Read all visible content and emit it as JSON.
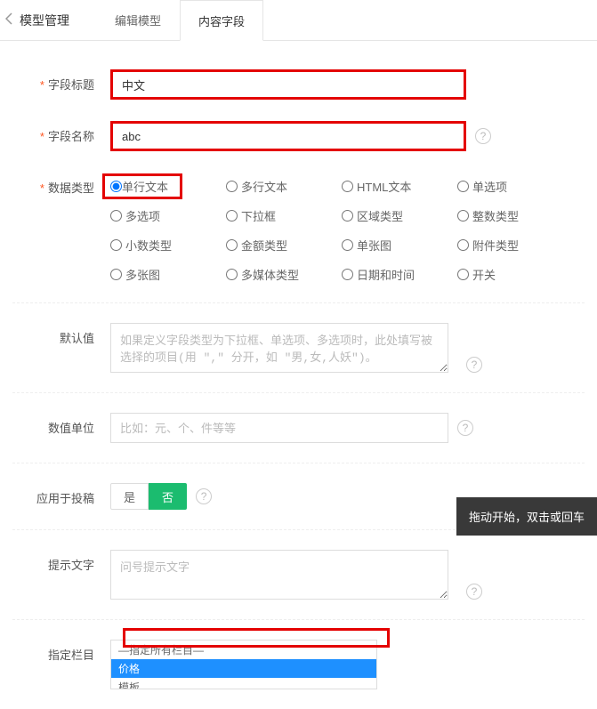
{
  "header": {
    "title": "模型管理",
    "tabs": [
      {
        "label": "编辑模型",
        "active": false
      },
      {
        "label": "内容字段",
        "active": true
      }
    ]
  },
  "form": {
    "field_title": {
      "label": "字段标题",
      "value": "中文"
    },
    "field_name": {
      "label": "字段名称",
      "value": "abc"
    },
    "data_type": {
      "label": "数据类型",
      "selected": "单行文本",
      "options": [
        "单行文本",
        "多行文本",
        "HTML文本",
        "单选项",
        "多选项",
        "下拉框",
        "区域类型",
        "整数类型",
        "小数类型",
        "金额类型",
        "单张图",
        "附件类型",
        "多张图",
        "多媒体类型",
        "日期和时间",
        "开关"
      ]
    },
    "default_value": {
      "label": "默认值",
      "placeholder": "如果定义字段类型为下拉框、单选项、多选项时，此处填写被选择的项目(用 \",\" 分开，如 \"男,女,人妖\")。"
    },
    "unit": {
      "label": "数值单位",
      "placeholder": "比如：元、个、件等等"
    },
    "contribute": {
      "label": "应用于投稿",
      "yes": "是",
      "no": "否",
      "value": "no"
    },
    "hint": {
      "label": "提示文字",
      "placeholder": "问号提示文字"
    },
    "column": {
      "label": "指定栏目",
      "options": [
        "—指定所有栏目—",
        "价格",
        "模板"
      ],
      "selected_index": 1
    }
  },
  "snack": "拖动开始，双击或回车"
}
